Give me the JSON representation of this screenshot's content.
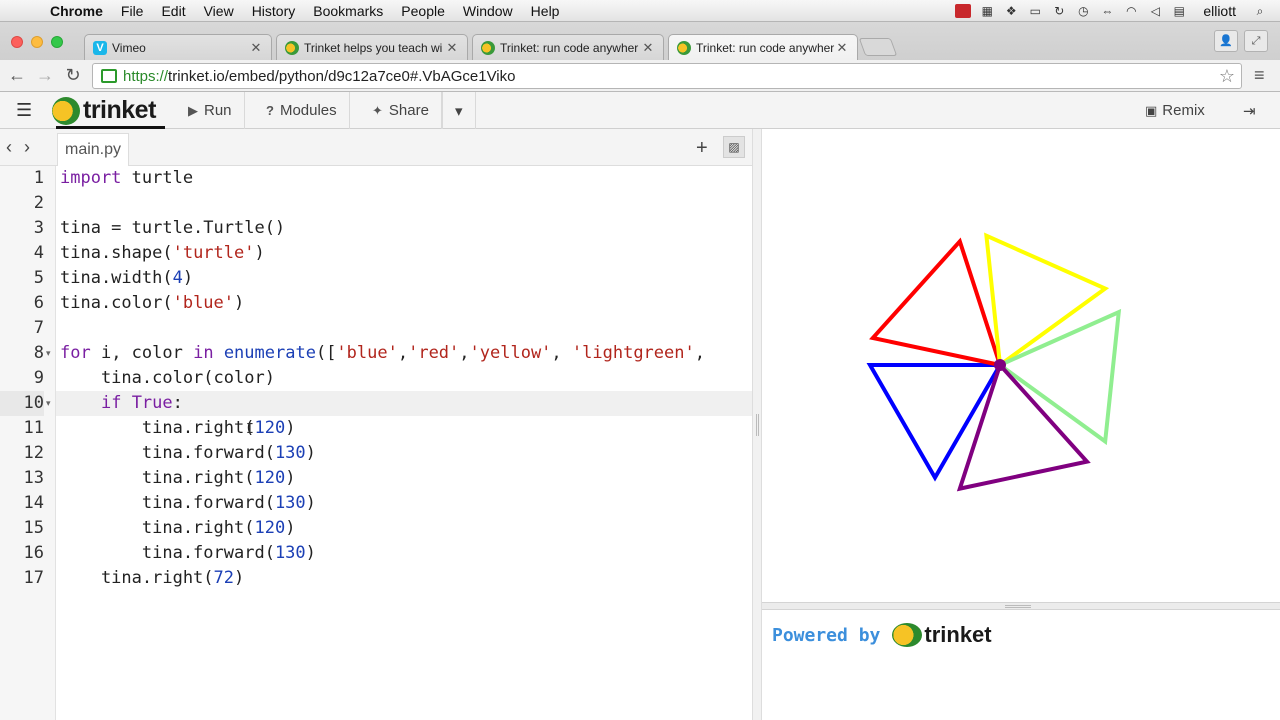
{
  "menubar": {
    "app": "Chrome",
    "items": [
      "File",
      "Edit",
      "View",
      "History",
      "Bookmarks",
      "People",
      "Window",
      "Help"
    ],
    "user": "elliott"
  },
  "tabs": [
    {
      "title": "Vimeo",
      "favicon": "vimeo-icon",
      "active": false
    },
    {
      "title": "Trinket helps you teach wi",
      "favicon": "trinket-icon",
      "active": false
    },
    {
      "title": "Trinket: run code anywher",
      "favicon": "trinket-icon",
      "active": false
    },
    {
      "title": "Trinket: run code anywher",
      "favicon": "trinket-icon",
      "active": true
    }
  ],
  "omnibox": {
    "scheme": "https://",
    "url": "trinket.io/embed/python/d9c12a7ce0#.VbAGce1Viko"
  },
  "trinket": {
    "brand": "trinket",
    "run_label": "Run",
    "modules_label": "Modules",
    "share_label": "Share",
    "remix_label": "Remix",
    "file_tab": "main.py",
    "powered_by": "Powered by",
    "powered_brand": "trinket"
  },
  "code": {
    "highlight_line": 10,
    "lines": [
      "import turtle",
      "",
      "tina = turtle.Turtle()",
      "tina.shape('turtle')",
      "tina.width(4)",
      "tina.color('blue')",
      "",
      "for i, color in enumerate(['blue','red','yellow', 'lightgreen',",
      "    tina.color(color)",
      "    if True:",
      "        tina.right(120)",
      "        tina.forward(130)",
      "        tina.right(120)",
      "        tina.forward(130)",
      "        tina.right(120)",
      "        tina.forward(130)",
      "    tina.right(72)"
    ]
  },
  "drawing": {
    "line_width": 4,
    "triangles": [
      {
        "color": "#0000ff"
      },
      {
        "color": "#ff0000"
      },
      {
        "color": "#ffff00"
      },
      {
        "color": "#90ee90"
      },
      {
        "color": "#800080"
      }
    ]
  }
}
